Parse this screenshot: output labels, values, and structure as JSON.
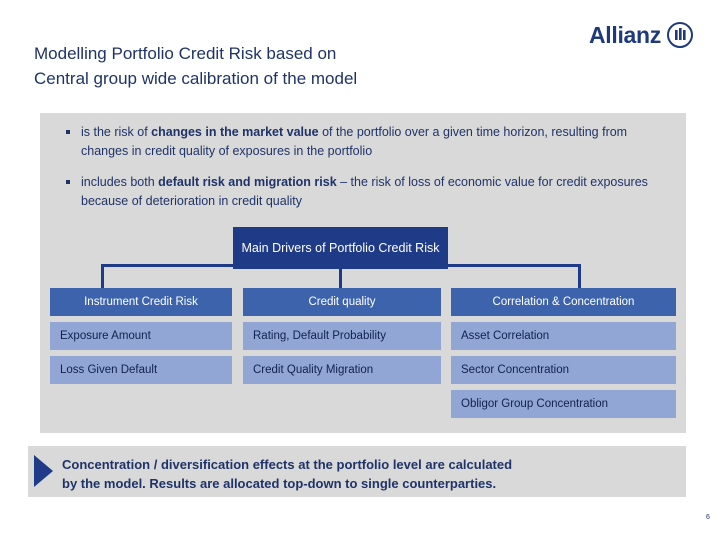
{
  "brand": {
    "logo_text": "Allianz",
    "logo_mark": "allianz-bars-icon",
    "navy": "#1f3a87",
    "mid_blue": "#3d63ad",
    "light_blue": "#91a6d4",
    "panel_gray": "#d9d9d9",
    "text_navy": "#1f3368"
  },
  "title": {
    "line1": "Modelling Portfolio Credit Risk based on",
    "line2": "Central group wide calibration of the model"
  },
  "bullets": [
    {
      "marker": "square-bullet",
      "pre": "is the risk of ",
      "bold": "changes in the market value",
      "post": " of the portfolio over a given time horizon, resulting from changes in credit quality of exposures in the portfolio"
    },
    {
      "marker": "square-bullet",
      "pre": "includes both ",
      "bold": "default risk and migration risk",
      "post": " – the risk of loss of economic value for credit exposures because of deterioration in credit quality"
    }
  ],
  "diagram": {
    "header": "Main Drivers of Portfolio Credit Risk",
    "columns": [
      {
        "header": "Instrument Credit Risk",
        "items": [
          "Exposure Amount",
          "Loss Given Default"
        ]
      },
      {
        "header": "Credit quality",
        "items": [
          "Rating, Default Probability",
          "Credit Quality Migration"
        ]
      },
      {
        "header": "Correlation & Concentration",
        "items": [
          "Asset Correlation",
          "Sector Concentration",
          "Obligor Group Concentration"
        ]
      }
    ]
  },
  "callout": {
    "arrow": "triangle-right-icon",
    "line1": "Concentration / diversification effects at the portfolio level are calculated",
    "line2": "by the model. Results are allocated top-down to single counterparties."
  },
  "footer": {
    "page_number": "6"
  }
}
